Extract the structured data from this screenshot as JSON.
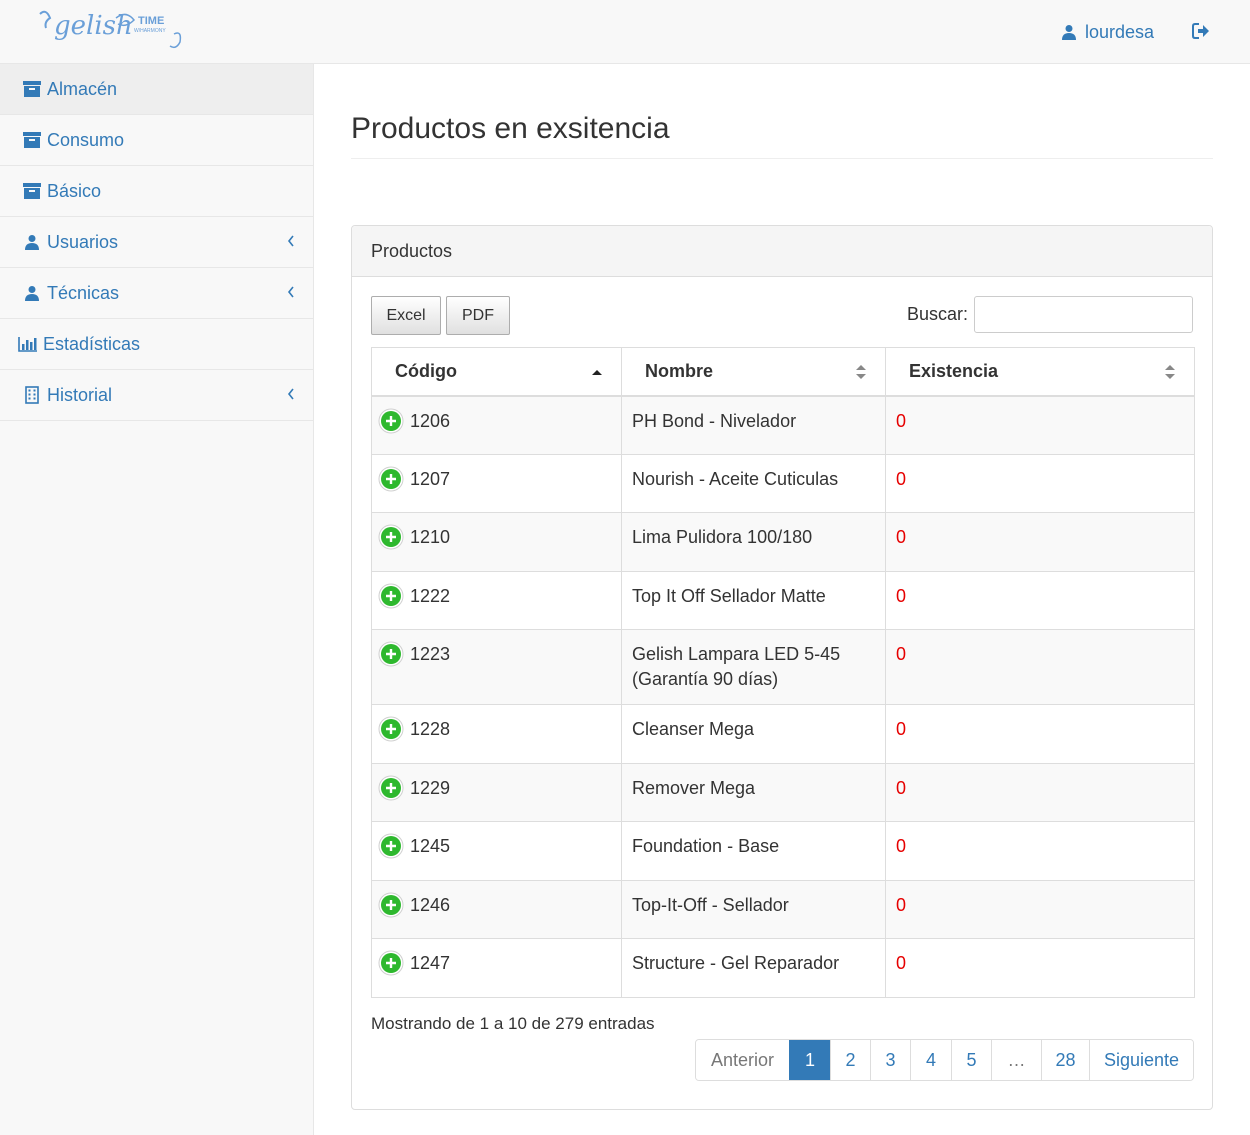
{
  "brand": {
    "name": "gelish",
    "tagline": "TIME",
    "sub": "W/HARMONY"
  },
  "navbar": {
    "username": "lourdesa"
  },
  "sidebar": {
    "items": [
      {
        "label": "Almacén",
        "icon": "archive-icon",
        "active": true
      },
      {
        "label": "Consumo",
        "icon": "archive-icon"
      },
      {
        "label": "Básico",
        "icon": "archive-icon"
      },
      {
        "label": "Usuarios",
        "icon": "user-icon",
        "has_children": true
      },
      {
        "label": "Técnicas",
        "icon": "user-icon",
        "has_children": true
      },
      {
        "label": "Estadísticas",
        "icon": "bar-chart-icon"
      },
      {
        "label": "Historial",
        "icon": "building-icon",
        "has_children": true
      }
    ]
  },
  "page": {
    "title": "Productos en exsitencia"
  },
  "panel": {
    "heading": "Productos",
    "export_buttons": [
      "Excel",
      "PDF"
    ],
    "search_label": "Buscar:",
    "search_value": ""
  },
  "table": {
    "columns": [
      "Código",
      "Nombre",
      "Existencia"
    ],
    "sorted_column": "Código",
    "sort_direction": "asc",
    "rows": [
      {
        "code": "1206",
        "name": "PH Bond - Nivelador",
        "stock": "0"
      },
      {
        "code": "1207",
        "name": "Nourish - Aceite Cuticulas",
        "stock": "0"
      },
      {
        "code": "1210",
        "name": "Lima Pulidora 100/180",
        "stock": "0"
      },
      {
        "code": "1222",
        "name": "Top It Off Sellador Matte",
        "stock": "0"
      },
      {
        "code": "1223",
        "name": "Gelish Lampara LED 5-45 (Garantía 90 días)",
        "stock": "0"
      },
      {
        "code": "1228",
        "name": "Cleanser Mega",
        "stock": "0"
      },
      {
        "code": "1229",
        "name": "Remover Mega",
        "stock": "0"
      },
      {
        "code": "1245",
        "name": "Foundation - Base",
        "stock": "0"
      },
      {
        "code": "1246",
        "name": "Top-It-Off - Sellador",
        "stock": "0"
      },
      {
        "code": "1247",
        "name": "Structure - Gel Reparador",
        "stock": "0"
      }
    ]
  },
  "footer": {
    "info": "Mostrando de 1 a 10 de 279 entradas",
    "pagination": {
      "previous": "Anterior",
      "next": "Siguiente",
      "pages": [
        "1",
        "2",
        "3",
        "4",
        "5",
        "…",
        "28"
      ],
      "current": "1"
    }
  },
  "colors": {
    "link": "#337ab7",
    "stock_zero": "#e60000",
    "add_icon": "#2eb82e"
  }
}
